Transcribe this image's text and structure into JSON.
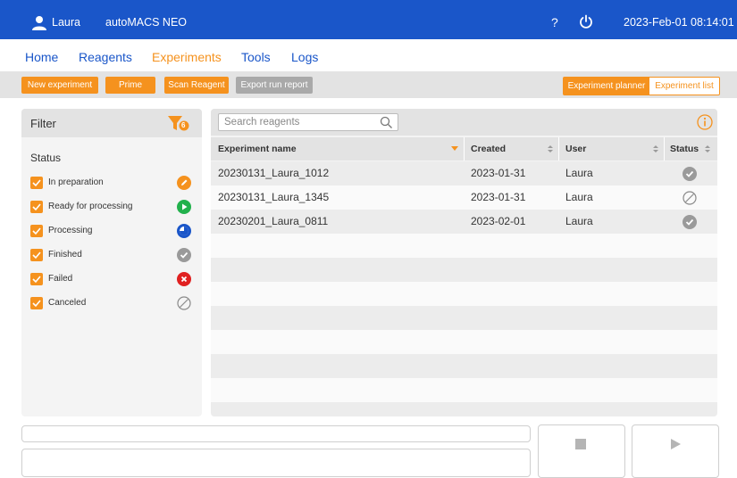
{
  "header": {
    "user_name": "Laura",
    "app_name": "autoMACS NEO",
    "help_label": "?",
    "datetime": "2023-Feb-01  08:14:01"
  },
  "nav": {
    "home": "Home",
    "reagents": "Reagents",
    "experiments": "Experiments",
    "tools": "Tools",
    "logs": "Logs"
  },
  "toolbar": {
    "new_experiment": "New experiment",
    "prime": "Prime",
    "scan_reagent": "Scan Reagent",
    "export_run_report": "Export run report",
    "experiment_planner": "Experiment planner",
    "experiment_list": "Experiment list"
  },
  "filter": {
    "title": "Filter",
    "badge_count": "6",
    "status_heading": "Status",
    "statuses": [
      {
        "label": "In preparation",
        "icon": "pencil-icon",
        "color": "#f5921e"
      },
      {
        "label": "Ready for processing",
        "icon": "play-icon",
        "color": "#22b14c"
      },
      {
        "label": "Processing",
        "icon": "progress-icon",
        "color": "#1a56c9"
      },
      {
        "label": "Finished",
        "icon": "check-icon",
        "color": "#9a9a9a"
      },
      {
        "label": "Failed",
        "icon": "x-icon",
        "color": "#e02020"
      },
      {
        "label": "Canceled",
        "icon": "cancel-icon",
        "color": "#9a9a9a"
      }
    ]
  },
  "search": {
    "placeholder": "Search reagents"
  },
  "table": {
    "columns": [
      "Experiment name",
      "Created",
      "User",
      "Status"
    ],
    "rows": [
      {
        "name": "20230131_Laura_1012",
        "created": "2023-01-31",
        "user": "Laura",
        "status": "finished"
      },
      {
        "name": "20230131_Laura_1345",
        "created": "2023-01-31",
        "user": "Laura",
        "status": "canceled"
      },
      {
        "name": "20230201_Laura_0811",
        "created": "2023-02-01",
        "user": "Laura",
        "status": "finished"
      }
    ]
  },
  "colors": {
    "brand_blue": "#1a56c9",
    "accent_orange": "#f5921e"
  }
}
